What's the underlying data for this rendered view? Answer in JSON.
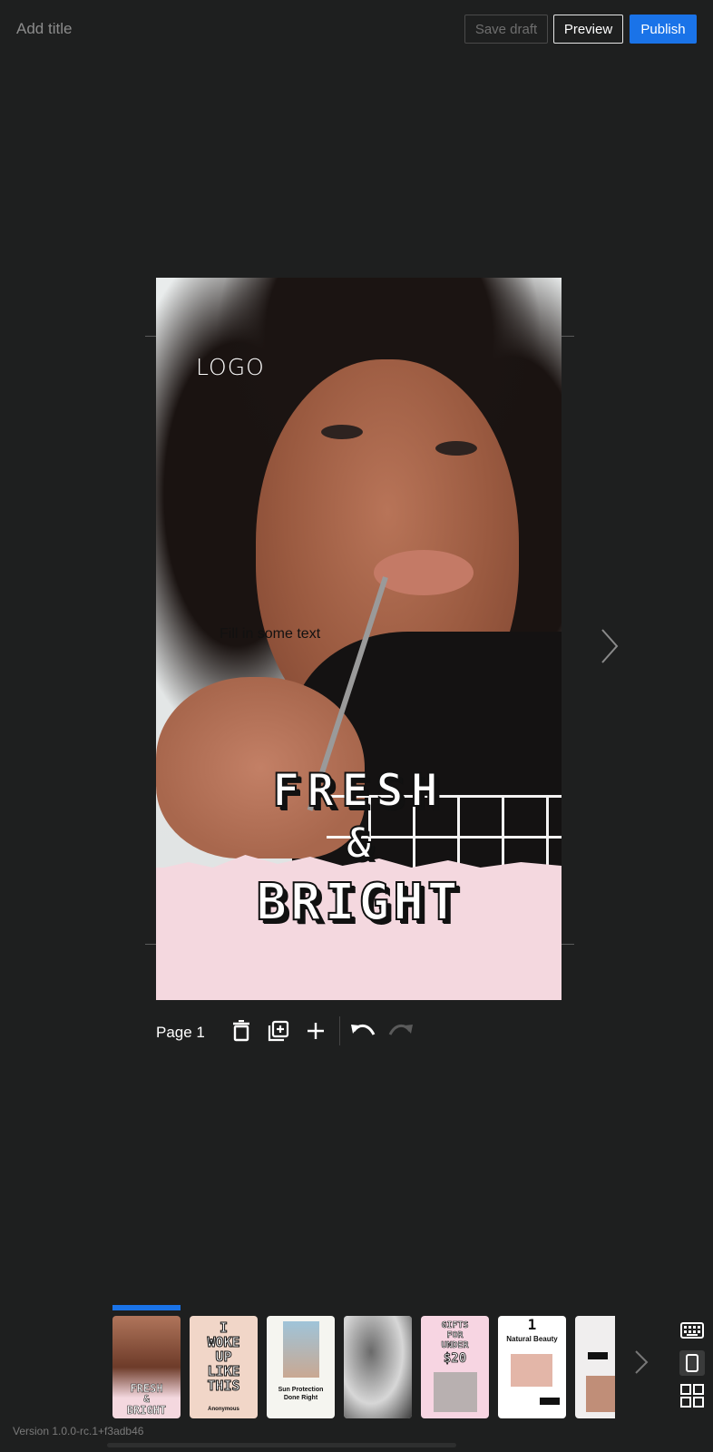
{
  "header": {
    "title_placeholder": "Add title",
    "save_draft_label": "Save draft",
    "preview_label": "Preview",
    "publish_label": "Publish"
  },
  "canvas": {
    "logo_text": "LOGO",
    "body_text": "Fill in some text",
    "headline_line1": "FRESH",
    "headline_line2": "&",
    "headline_line3": "BRIGHT"
  },
  "page_toolbar": {
    "page_label": "Page 1",
    "icons": [
      "delete-icon",
      "duplicate-icon",
      "add-icon",
      "undo-icon",
      "redo-icon"
    ]
  },
  "carousel": {
    "thumbnails": [
      {
        "lines": [
          "FRESH",
          "&",
          "BRIGHT"
        ],
        "active": true
      },
      {
        "lines": [
          "I",
          "WOKE",
          "UP",
          "LIKE",
          "THIS"
        ],
        "sub": "Anonymous"
      },
      {
        "lines": [
          "Sun Protection",
          "Done Right"
        ]
      },
      {
        "lines": []
      },
      {
        "lines": [
          "GIFTS",
          "FOR",
          "UNDER",
          "$20"
        ]
      },
      {
        "lines": [
          "1",
          "Natural Beauty"
        ]
      },
      {
        "lines": []
      }
    ]
  },
  "version_text": "Version 1.0.0-rc.1+f3adb46",
  "colors": {
    "accent": "#1a73e8",
    "background": "#1e1f1f",
    "pink": "#f4d8df"
  }
}
